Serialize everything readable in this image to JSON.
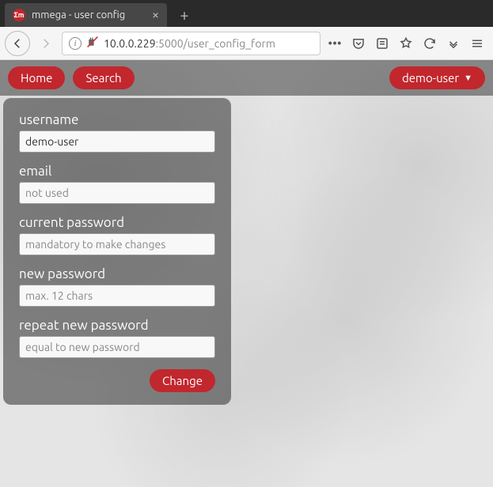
{
  "browser": {
    "tab_title": "mmega - user config",
    "url_host": "10.0.0.229",
    "url_rest": ":5000/user_config_form"
  },
  "nav": {
    "home": "Home",
    "search": "Search",
    "user": "demo-user"
  },
  "form": {
    "username": {
      "label": "username",
      "value": "demo-user"
    },
    "email": {
      "label": "email",
      "placeholder": "not used"
    },
    "current_password": {
      "label": "current password",
      "placeholder": "mandatory to make changes"
    },
    "new_password": {
      "label": "new password",
      "placeholder": "max. 12 chars"
    },
    "repeat_password": {
      "label": "repeat new password",
      "placeholder": "equal to new password"
    },
    "submit": "Change"
  }
}
